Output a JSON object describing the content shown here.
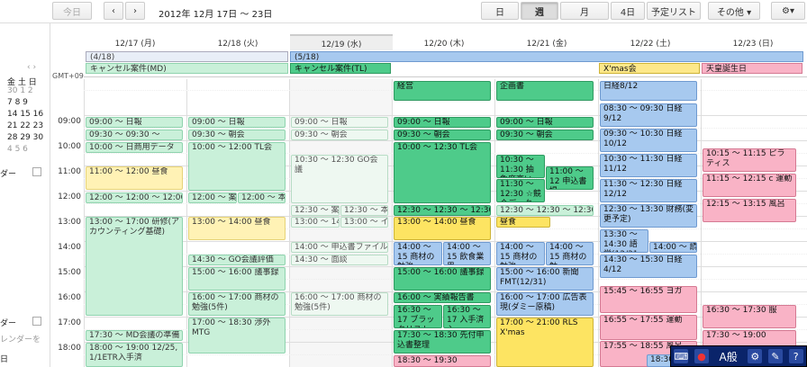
{
  "toolbar": {
    "today": "今日",
    "prev": "‹",
    "next": "›",
    "range": "2012年 12月 17日 〜 23日",
    "views": [
      "日",
      "週",
      "月",
      "4日",
      "予定リスト"
    ],
    "other": "その他 ▾",
    "gear": "⚙▾"
  },
  "sidebar": {
    "month_header": "‹ ›",
    "weekdays": "金 土 日",
    "rows": [
      "30  1  2",
      "7  8  9",
      "14 15 16",
      "21 22 23",
      "28 29 30",
      "4  5  6"
    ],
    "label1": "ダー",
    "label2": "ダー",
    "label3": "レンダーを",
    "label4": "日"
  },
  "gmt": "GMT+09",
  "days": [
    "12/17 (月)",
    "12/18 (火)",
    "12/19 (水)",
    "12/20 (木)",
    "12/21 (金)",
    "12/22 (土)",
    "12/23 (日)"
  ],
  "allday": {
    "a1": "(4/18)",
    "a2": "(5/18)",
    "b1": "キャンセル案件(MD)",
    "b2": "キャンセル案件(TL)",
    "xmas": "X'mas会",
    "tenno": "天皇誕生日"
  },
  "hours": [
    "09:00",
    "10:00",
    "11:00",
    "12:00",
    "13:00",
    "14:00",
    "15:00",
    "16:00",
    "17:00",
    "18:00"
  ],
  "events": [
    {
      "t": "09:00 〜 日報"
    },
    {
      "t": "09:30 〜 09:30 〜"
    },
    {
      "t": "10:00 〜 日商用データ"
    },
    {
      "t": "11:00 〜 12:00 昼食"
    },
    {
      "t": "12:00 〜 12:00 〜 12:00 〜"
    },
    {
      "t": "13:00 〜 17:00 研修(アカウンティング基礎)"
    },
    {
      "t": "17:30 〜 MD会議の準備"
    },
    {
      "t": "18:00 〜 19:00 12/25, 1/1ETR入手済"
    },
    {
      "t": "09:00 〜 日報"
    },
    {
      "t": "09:30 〜 朝会"
    },
    {
      "t": "10:00 〜 12:00 TL会"
    },
    {
      "t": "12:00 〜 案"
    },
    {
      "t": "12:00 〜 本"
    },
    {
      "t": "13:00 〜 14:00 昼食"
    },
    {
      "t": "14:30 〜 GO会議評価"
    },
    {
      "t": "15:00 〜 16:00 議事録"
    },
    {
      "t": "16:00 〜 17:00 商材の勉強(5件)"
    },
    {
      "t": "17:00 〜 18:30 渉外MTG"
    },
    {
      "t": "09:00 〜 日報"
    },
    {
      "t": "09:30 〜 朝会"
    },
    {
      "t": "10:30 〜 12:30 GO会議"
    },
    {
      "t": "12:30 〜 案"
    },
    {
      "t": "12:30 〜 本"
    },
    {
      "t": "13:00 〜 14"
    },
    {
      "t": "13:00 〜 イ"
    },
    {
      "t": "14:00 〜 申込書ファイル"
    },
    {
      "t": "14:30 〜 面談"
    },
    {
      "t": "16:00 〜 17:00 商材の勉強(5件)"
    },
    {
      "t": "経営"
    },
    {
      "t": "09:00 〜 日報"
    },
    {
      "t": "09:30 〜 朝会"
    },
    {
      "t": "10:00 〜 12:30 TL会"
    },
    {
      "t": "12:30 〜 12:30 〜 12:30 〜"
    },
    {
      "t": "13:00 〜 14:00 昼食"
    },
    {
      "t": "14:00 〜 15 商材の勉強"
    },
    {
      "t": "14:00 〜 15 飲食業界"
    },
    {
      "t": "15:00 〜 16:00 議事録"
    },
    {
      "t": "16:00 〜 実績報告書"
    },
    {
      "t": "16:30 〜 17 ブラックリスト"
    },
    {
      "t": "16:30 〜 17 入手済入"
    },
    {
      "t": "17:30 〜 18:30 先付申込書整理"
    },
    {
      "t": "18:30 〜 19:30"
    },
    {
      "t": "企画書"
    },
    {
      "t": "09:00 〜 日報"
    },
    {
      "t": "09:30 〜 朝会"
    },
    {
      "t": "10:30 〜 11:30 抽象度高い"
    },
    {
      "t": "11:00 〜 12 申込書提"
    },
    {
      "t": "11:30 〜 12:30 ☆競合データ"
    },
    {
      "t": "12:30 〜 12:30 〜 12:30 〜"
    },
    {
      "t": "昼食"
    },
    {
      "t": "14:00 〜 15 商材の勉強"
    },
    {
      "t": "14:00 〜 15 商材の勉"
    },
    {
      "t": "15:00 〜 16:00 新聞FMT(12/31)"
    },
    {
      "t": "16:00 〜 17:00 広告表現(ダミー原稿)"
    },
    {
      "t": "17:00 〜 21:00 RLS X'mas"
    },
    {
      "t": "日経8/12"
    },
    {
      "t": "08:30 〜 09:30 日経9/12"
    },
    {
      "t": "09:30 〜 10:30 日経10/12"
    },
    {
      "t": "10:30 〜 11:30 日経11/12"
    },
    {
      "t": "11:30 〜 12:30 日経12/12"
    },
    {
      "t": "12:30 〜 13:30 財務(変更予定)"
    },
    {
      "t": "13:30 〜 14:30 語学(12/31"
    },
    {
      "t": "14:00 〜 読"
    },
    {
      "t": "14:30 〜 15:30 日経4/12"
    },
    {
      "t": "15:45 〜 16:55 ヨガ"
    },
    {
      "t": "16:55 〜 17:55 運動"
    },
    {
      "t": "17:55 〜 18:55 風呂"
    },
    {
      "t": "18:30"
    },
    {
      "t": "10:15 〜 11:15 ピラティス"
    },
    {
      "t": "11:15 〜 12:15 c 運動"
    },
    {
      "t": "12:15 〜 13:15 風呂"
    },
    {
      "t": "16:30 〜 17:30 服"
    },
    {
      "t": "17:30 〜 19:00"
    }
  ],
  "ime": [
    "⌨",
    "●",
    "A般",
    "⚙",
    "✎",
    "?"
  ]
}
